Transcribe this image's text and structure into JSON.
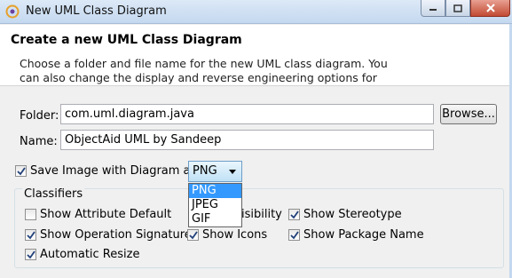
{
  "window": {
    "title": "New UML Class Diagram",
    "controls": [
      "minimize",
      "maximize",
      "close"
    ]
  },
  "banner": {
    "title": "Create a new UML Class Diagram",
    "description": "Choose a folder and file name for the new UML class diagram. You can also change the display and reverse engineering options for"
  },
  "form": {
    "folder_label": "Folder:",
    "folder_value": "com.uml.diagram.java",
    "browse_label": "Browse...",
    "name_label": "Name:",
    "name_value": "ObjectAid UML by Sandeep",
    "save_image_label": "Save Image with Diagram as",
    "save_image_checked": true,
    "format_selected": "PNG",
    "format_options": [
      "PNG",
      "JPEG",
      "GIF"
    ]
  },
  "classifiers": {
    "title": "Classifiers",
    "options": {
      "attr_default": {
        "label": "Show Attribute Default",
        "checked": false
      },
      "visibility": {
        "label": "isibility",
        "checked": true
      },
      "stereotype": {
        "label": "Show Stereotype",
        "checked": true
      },
      "op_signature": {
        "label": "Show Operation Signature",
        "checked": true
      },
      "icons": {
        "label": "Show Icons",
        "checked": true
      },
      "package_name": {
        "label": "Show Package Name",
        "checked": true
      },
      "auto_resize": {
        "label": "Automatic Resize",
        "checked": true
      }
    }
  },
  "colors": {
    "selection": "#3399ff",
    "titlebar": "#c4d8ef",
    "close_button": "#c24a33"
  }
}
